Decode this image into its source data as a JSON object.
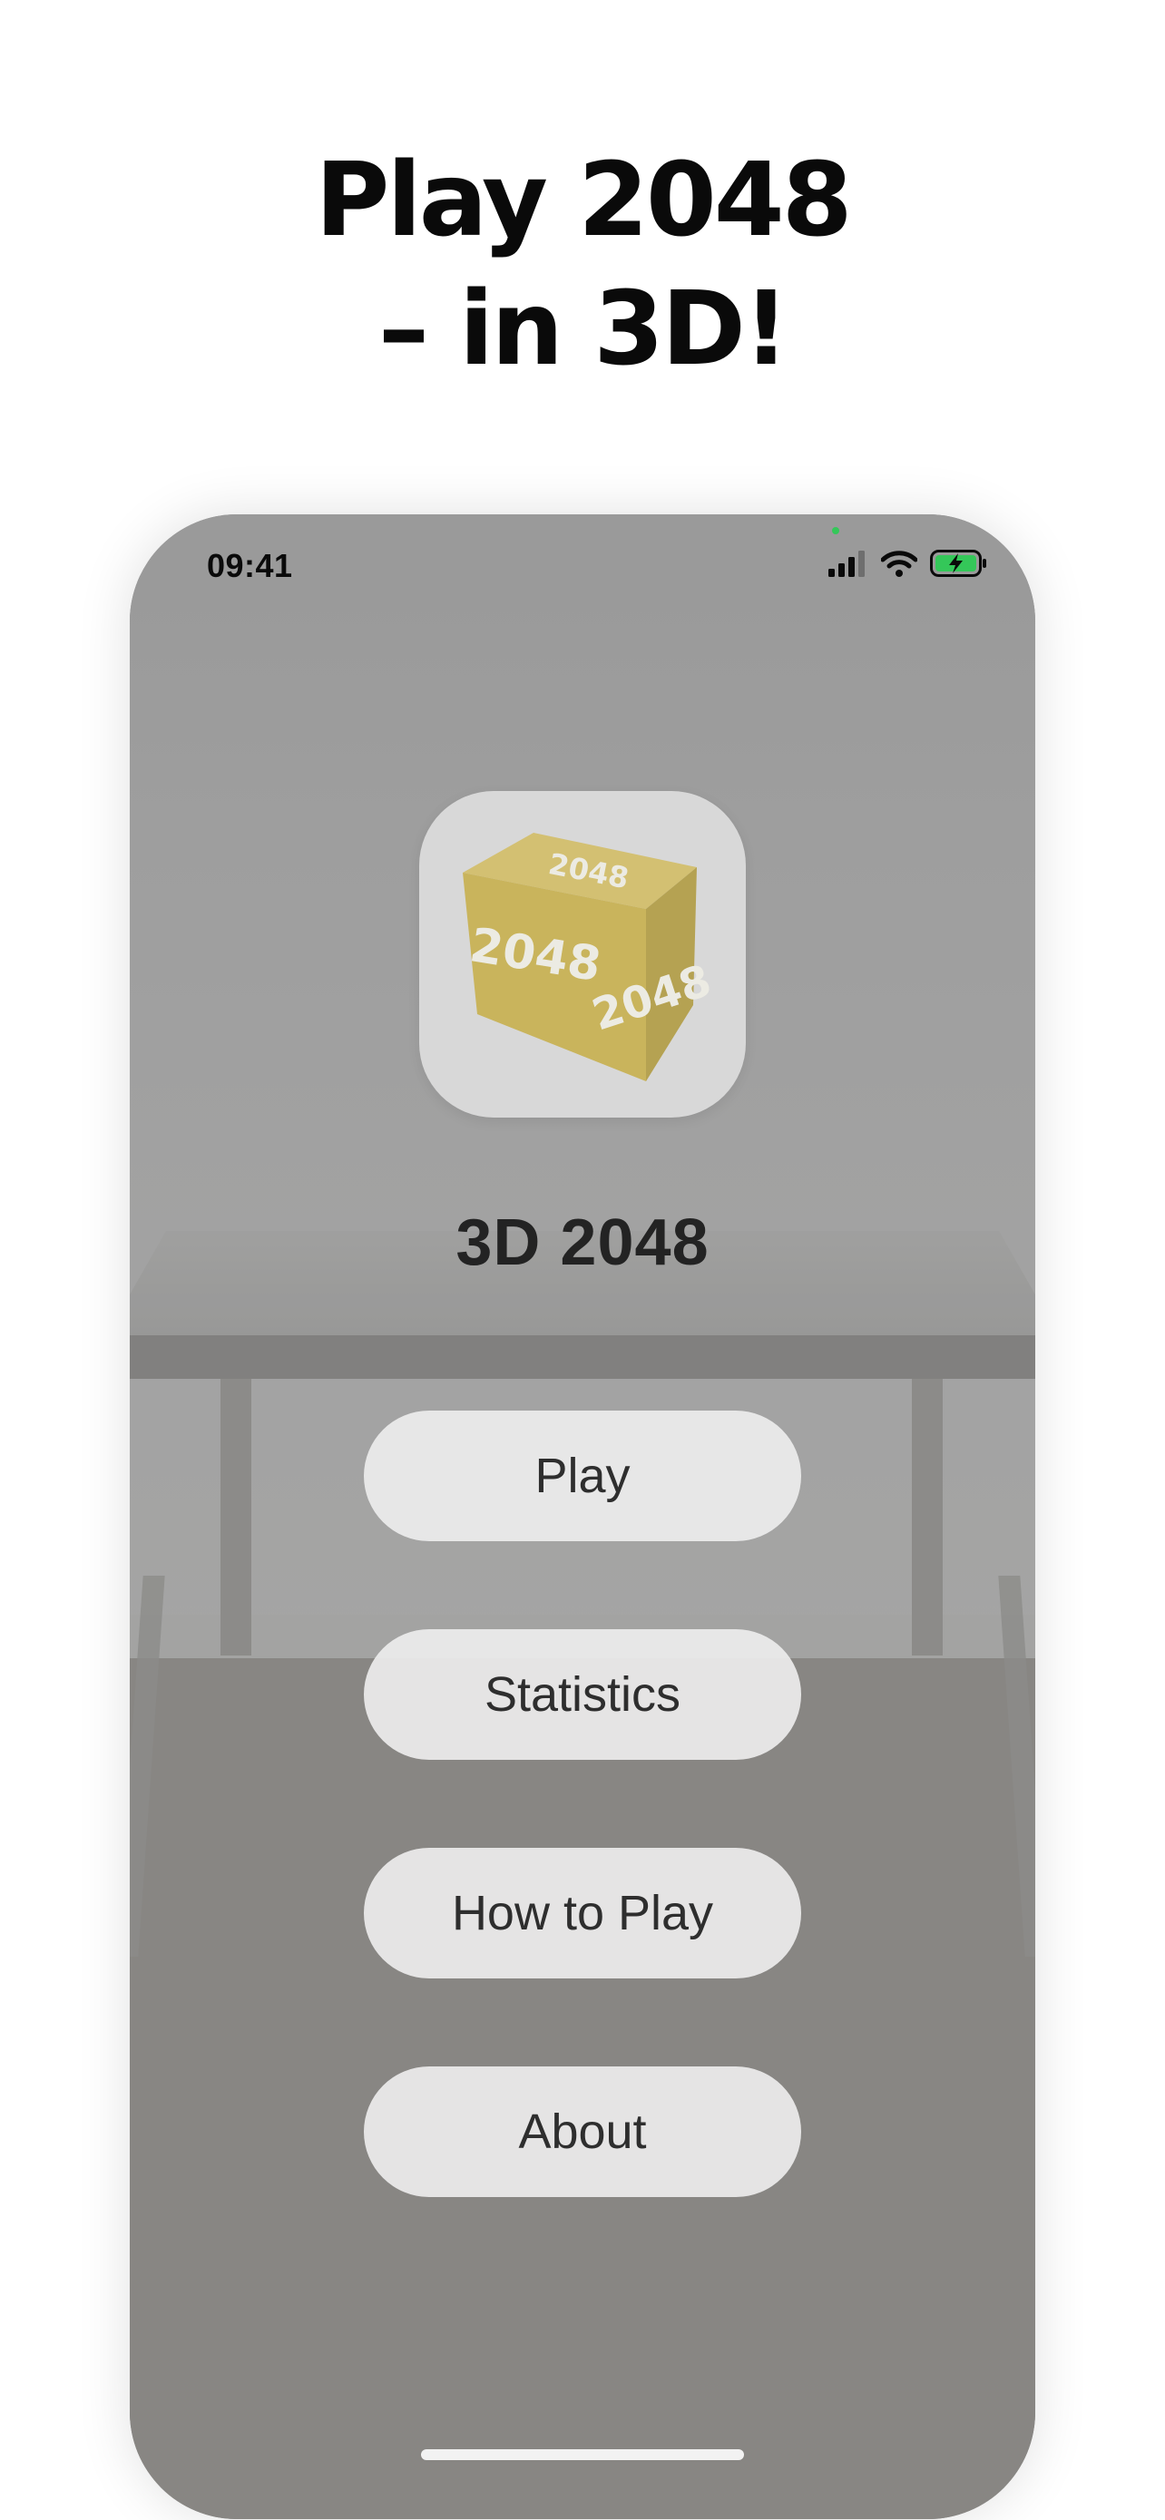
{
  "promo": {
    "headline_line1": "Play 2048",
    "headline_line2": "– in 3D!"
  },
  "status_bar": {
    "time": "09:41",
    "icons": [
      "cellular-signal-icon",
      "wifi-icon",
      "battery-charging-icon"
    ]
  },
  "app": {
    "icon_name": "cube-2048-app-icon",
    "cube_face_text": "2048",
    "title": "3D 2048"
  },
  "menu": {
    "play_label": "Play",
    "statistics_label": "Statistics",
    "how_to_play_label": "How to Play",
    "about_label": "About"
  },
  "colors": {
    "cube_front": "#c9b45c",
    "cube_side": "#b5a252",
    "cube_top": "#d3c072",
    "battery_fill": "#34c759",
    "button_bg": "#ececec"
  }
}
